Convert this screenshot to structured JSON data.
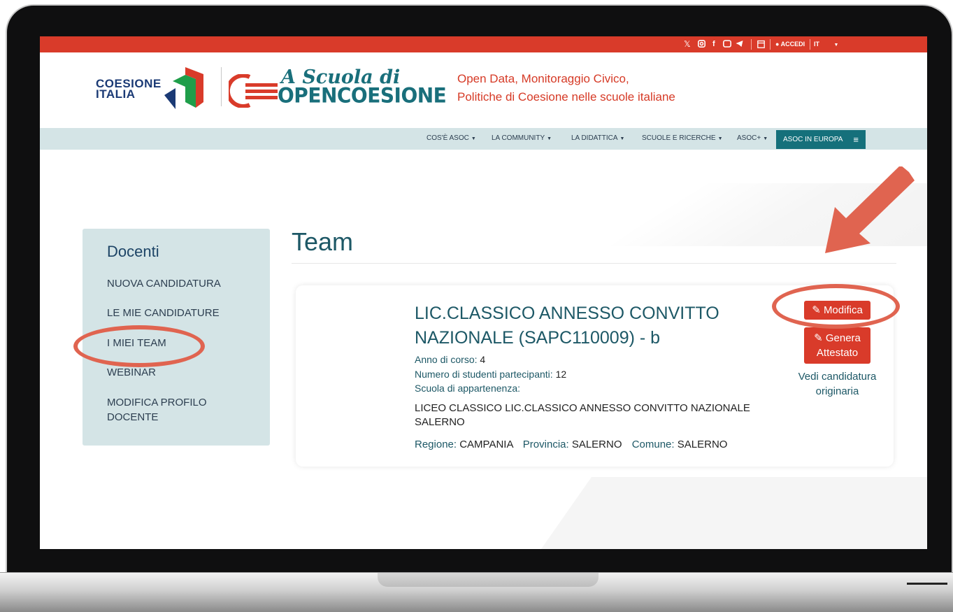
{
  "topbar": {
    "social_icons": [
      "x-icon",
      "instagram-icon",
      "facebook-icon",
      "youtube-icon",
      "telegram-icon"
    ],
    "calendar_icon": "calendar-icon",
    "login_label": "ACCEDI",
    "language": "IT",
    "colors": {
      "bar": "#d93b2a"
    }
  },
  "header": {
    "coesione_logo": "COESIONE\nITALIA",
    "asoc_line1": "A Scuola di",
    "asoc_line2": "OPENCOESIONE",
    "tagline_1": "Open Data, Monitoraggio Civico,",
    "tagline_2": "Politiche di Coesione nelle scuole italiane"
  },
  "nav": {
    "items": [
      {
        "label": "COS'È ASOC"
      },
      {
        "label": "LA COMMUNITY"
      },
      {
        "label": "LA DIDATTICA"
      },
      {
        "label": "SCUOLE E RICERCHE"
      },
      {
        "label": "ASOC+"
      }
    ],
    "cta": "ASOC IN EUROPA"
  },
  "sidebar": {
    "title": "Docenti",
    "links": [
      {
        "label": "NUOVA CANDIDATURA"
      },
      {
        "label": "LE MIE CANDIDATURE"
      },
      {
        "label": "I MIEI TEAM"
      },
      {
        "label": "WEBINAR"
      },
      {
        "label": "MODIFICA PROFILO DOCENTE"
      }
    ]
  },
  "main": {
    "page_title": "Team",
    "team": {
      "name": "LIC.CLASSICO ANNESSO CONVITTO NAZIONALE (SAPC110009) - b",
      "anno_label": "Anno di corso:",
      "anno_value": "4",
      "studenti_label": "Numero di studenti partecipanti:",
      "studenti_value": "12",
      "scuola_label": "Scuola di appartenenza:",
      "scuola_value": "LICEO CLASSICO LIC.CLASSICO ANNESSO CONVITTO NAZIONALE SALERNO",
      "regione_label": "Regione:",
      "regione_value": "CAMPANIA",
      "provincia_label": "Provincia:",
      "provincia_value": "SALERNO",
      "comune_label": "Comune:",
      "comune_value": "SALERNO"
    },
    "actions": {
      "modifica": "Modifica",
      "genera_attestato": "Genera Attestato",
      "vedi_candidatura": "Vedi candidatura originaria"
    }
  },
  "colors": {
    "accent_red": "#d93b2a",
    "teal": "#15707b",
    "annotation": "#e06450"
  }
}
